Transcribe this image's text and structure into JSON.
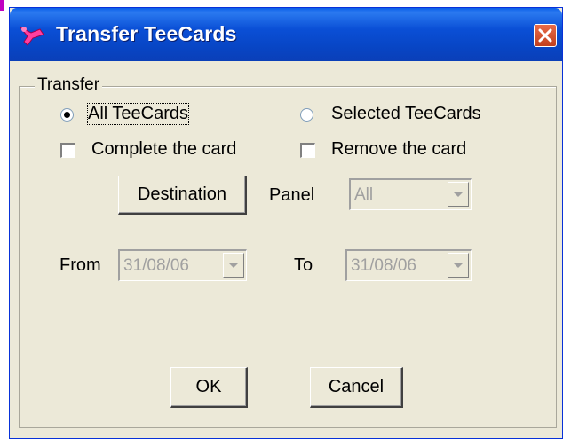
{
  "window": {
    "title": "Transfer TeeCards"
  },
  "group": {
    "label": "Transfer"
  },
  "options": {
    "all_teecards": "All TeeCards",
    "all_teecards_selected": true,
    "selected_teecards": "Selected TeeCards",
    "selected_teecards_selected": false,
    "complete_card": "Complete the card",
    "complete_card_checked": false,
    "remove_card": "Remove the card",
    "remove_card_checked": false
  },
  "destination": {
    "button_label": "Destination"
  },
  "panel": {
    "label": "Panel",
    "value": "All"
  },
  "dates": {
    "from_label": "From",
    "from_value": "31/08/06",
    "to_label": "To",
    "to_value": "31/08/06"
  },
  "actions": {
    "ok_label": "OK",
    "cancel_label": "Cancel"
  },
  "colors": {
    "titlebar": "#0a4fd6",
    "window_bg": "#ece9d8",
    "close_button": "#d4542b",
    "disabled_text": "#a0a0a0"
  }
}
